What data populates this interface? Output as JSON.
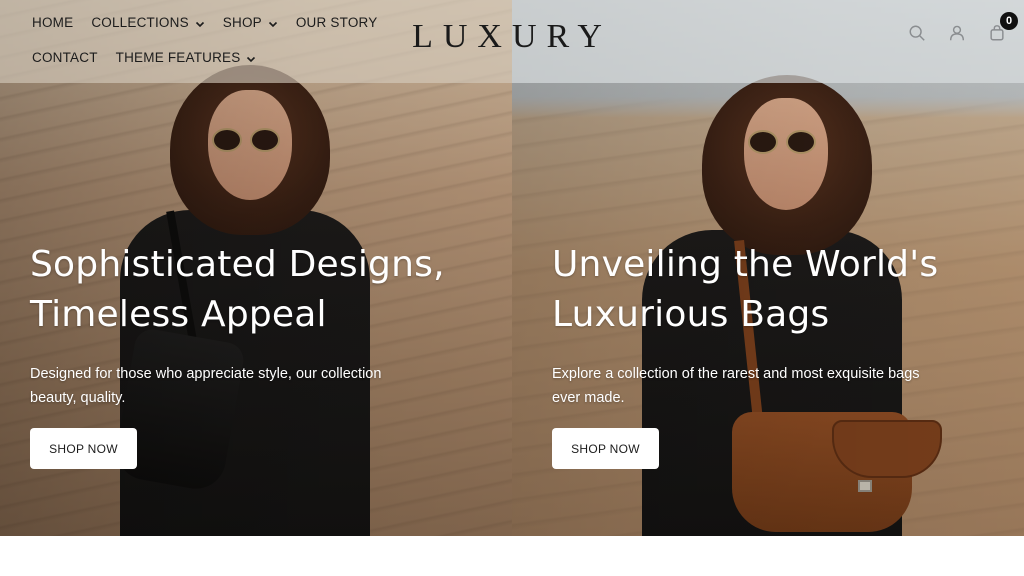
{
  "nav": {
    "row1": [
      {
        "label": "HOME",
        "dropdown": false
      },
      {
        "label": "COLLECTIONS",
        "dropdown": true
      },
      {
        "label": "SHOP",
        "dropdown": true
      },
      {
        "label": "OUR STORY",
        "dropdown": false
      }
    ],
    "row2": [
      {
        "label": "CONTACT",
        "dropdown": false
      },
      {
        "label": "THEME FEATURES",
        "dropdown": true
      }
    ]
  },
  "brand": {
    "logo": "LUXURY"
  },
  "header_icons": {
    "search": "search-icon",
    "account": "user-icon",
    "cart": "bag-icon",
    "cart_count": "0"
  },
  "slides": [
    {
      "title_line1": "Sophisticated Designs,",
      "title_line2": "Timeless Appeal",
      "text": "Designed for those who appreciate style, our collection beauty, quality.",
      "button": "SHOP NOW"
    },
    {
      "title_line1": "Unveiling the World's",
      "title_line2": "Luxurious Bags",
      "text": "Explore a collection of the rarest and most exquisite bags ever made.",
      "button": "SHOP NOW"
    }
  ],
  "colors": {
    "text_dark": "#1c1c1c",
    "button_bg": "#ffffff",
    "cart_badge": "#111111"
  }
}
